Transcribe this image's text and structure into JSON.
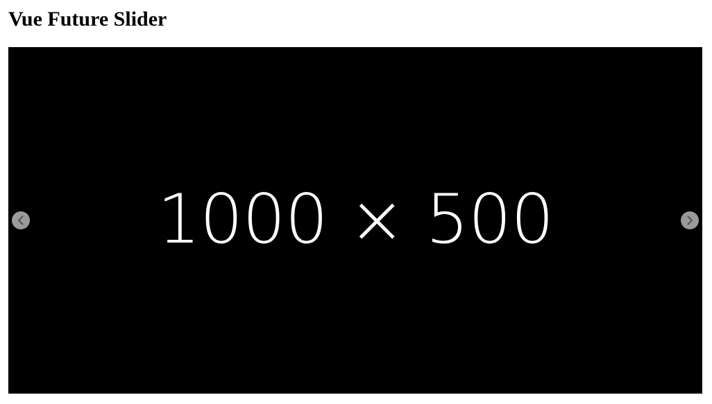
{
  "page": {
    "title": "Vue Future Slider"
  },
  "slider": {
    "current_slide": {
      "placeholder_text": "1000 × 500",
      "background_color": "#000000",
      "text_color": "#ffffff"
    },
    "controls": {
      "prev_icon": "chevron-left-icon",
      "next_icon": "chevron-right-icon",
      "button_color": "#9a9a9a",
      "glyph_color": "#555555"
    }
  }
}
